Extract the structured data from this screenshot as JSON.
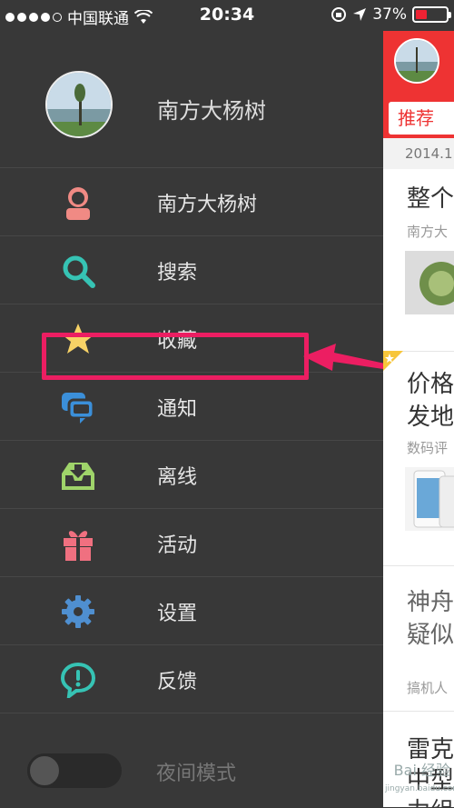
{
  "status_bar": {
    "carrier": "中国联通",
    "time": "20:34",
    "battery_percent": "37%",
    "battery_level": 0.37
  },
  "profile": {
    "name": "南方大杨树"
  },
  "menu": {
    "items": [
      {
        "label": "南方大杨树",
        "icon": "user-icon",
        "color": "#f08a84"
      },
      {
        "label": "搜索",
        "icon": "search-icon",
        "color": "#36c3b4"
      },
      {
        "label": "收藏",
        "icon": "star-icon",
        "color": "#f7d266"
      },
      {
        "label": "通知",
        "icon": "chat-bubbles-icon",
        "color": "#3b8fd9"
      },
      {
        "label": "离线",
        "icon": "download-tray-icon",
        "color": "#9fd46a"
      },
      {
        "label": "活动",
        "icon": "gift-icon",
        "color": "#f07080"
      },
      {
        "label": "设置",
        "icon": "gear-icon",
        "color": "#4f8fd0"
      },
      {
        "label": "反馈",
        "icon": "feedback-icon",
        "color": "#36c3b4"
      }
    ],
    "night_mode_label": "夜间模式",
    "night_mode_on": false
  },
  "annotation": {
    "highlight_color": "#ec1e62"
  },
  "content": {
    "tab_label": "推荐",
    "date": "2014.1",
    "cards": [
      {
        "title": "整个",
        "source": "南方大"
      },
      {
        "title_line1": "价格",
        "title_line2": "发地",
        "source": "数码评"
      },
      {
        "title_line1": "神舟",
        "title_line2": "疑似",
        "source": "搞机人"
      },
      {
        "title_line1": "雷克",
        "title_line2": "中型",
        "title_line3": "力组"
      }
    ],
    "watermark": "Bai 经验",
    "watermark_url": "jingyan.baidu.com"
  }
}
